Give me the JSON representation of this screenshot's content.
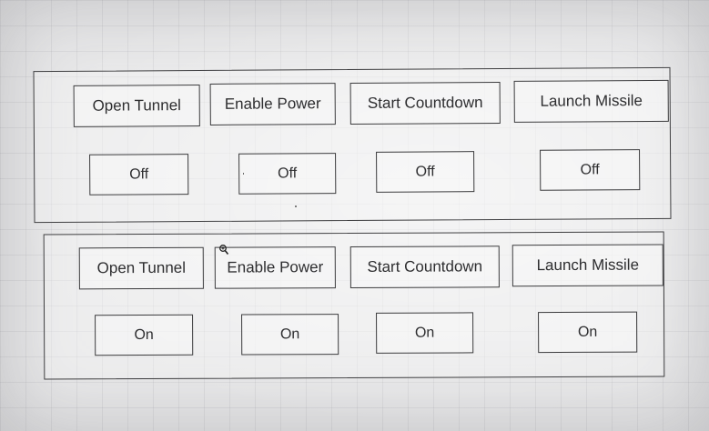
{
  "panels": [
    {
      "actions": [
        "Open Tunnel",
        "Enable Power",
        "Start Countdown",
        "Launch Missile"
      ],
      "toggles": [
        "Off",
        "Off",
        "Off",
        "Off"
      ]
    },
    {
      "actions": [
        "Open Tunnel",
        "Enable Power",
        "Start Countdown",
        "Launch Missile"
      ],
      "toggles": [
        "On",
        "On",
        "On",
        "On"
      ]
    }
  ],
  "icons": {
    "cursor": "magnifier-cursor-icon"
  }
}
